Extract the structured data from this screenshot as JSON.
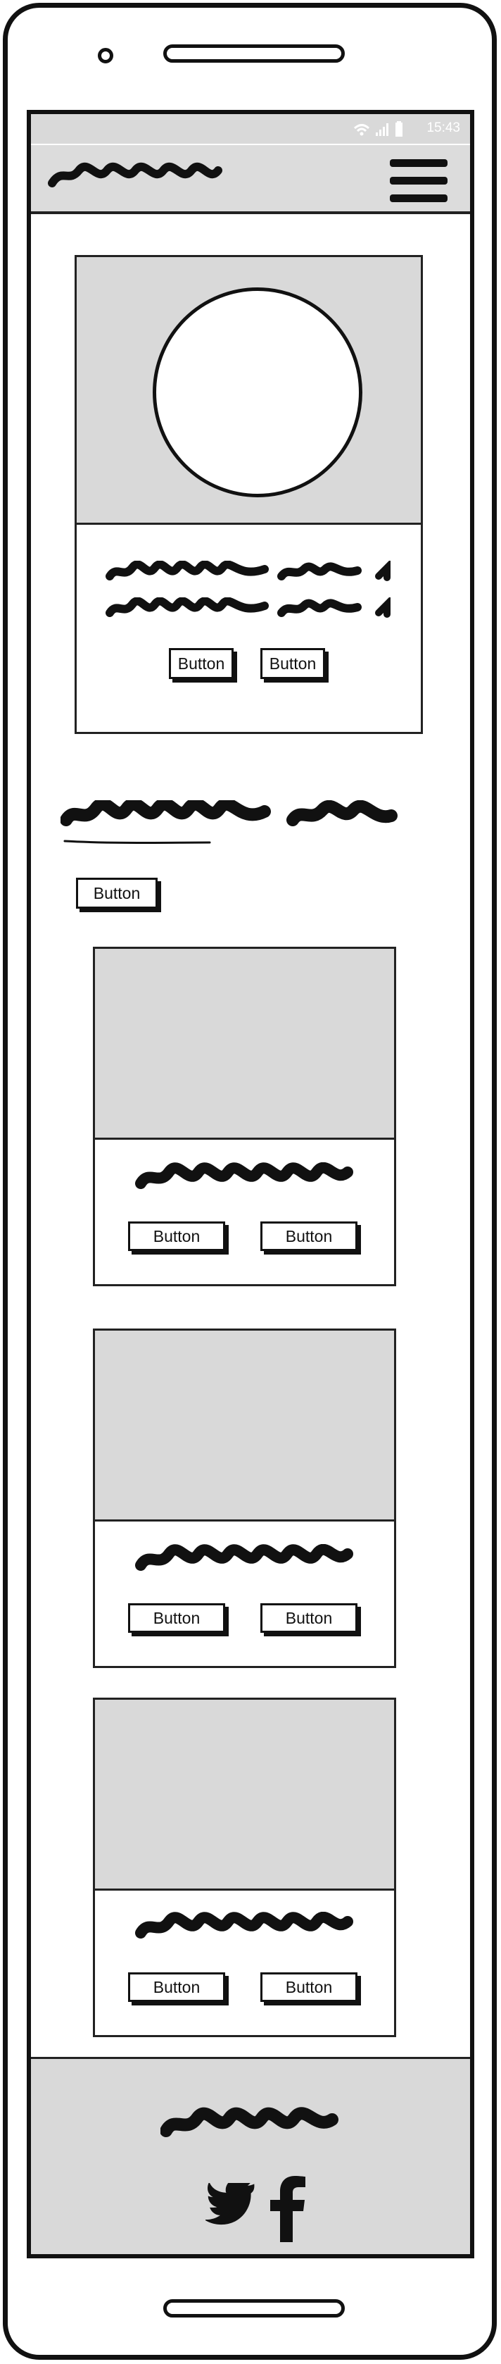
{
  "status_bar": {
    "time": "15:43"
  },
  "hero": {
    "buttons": [
      {
        "label": "Button"
      },
      {
        "label": "Button"
      }
    ]
  },
  "section": {
    "button_label": "Button"
  },
  "cards": [
    {
      "buttons": [
        {
          "label": "Button"
        },
        {
          "label": "Button"
        }
      ]
    },
    {
      "buttons": [
        {
          "label": "Button"
        },
        {
          "label": "Button"
        }
      ]
    },
    {
      "buttons": [
        {
          "label": "Button"
        },
        {
          "label": "Button"
        }
      ]
    }
  ],
  "footer": {
    "social_icons": [
      "twitter-icon",
      "facebook-icon"
    ]
  }
}
